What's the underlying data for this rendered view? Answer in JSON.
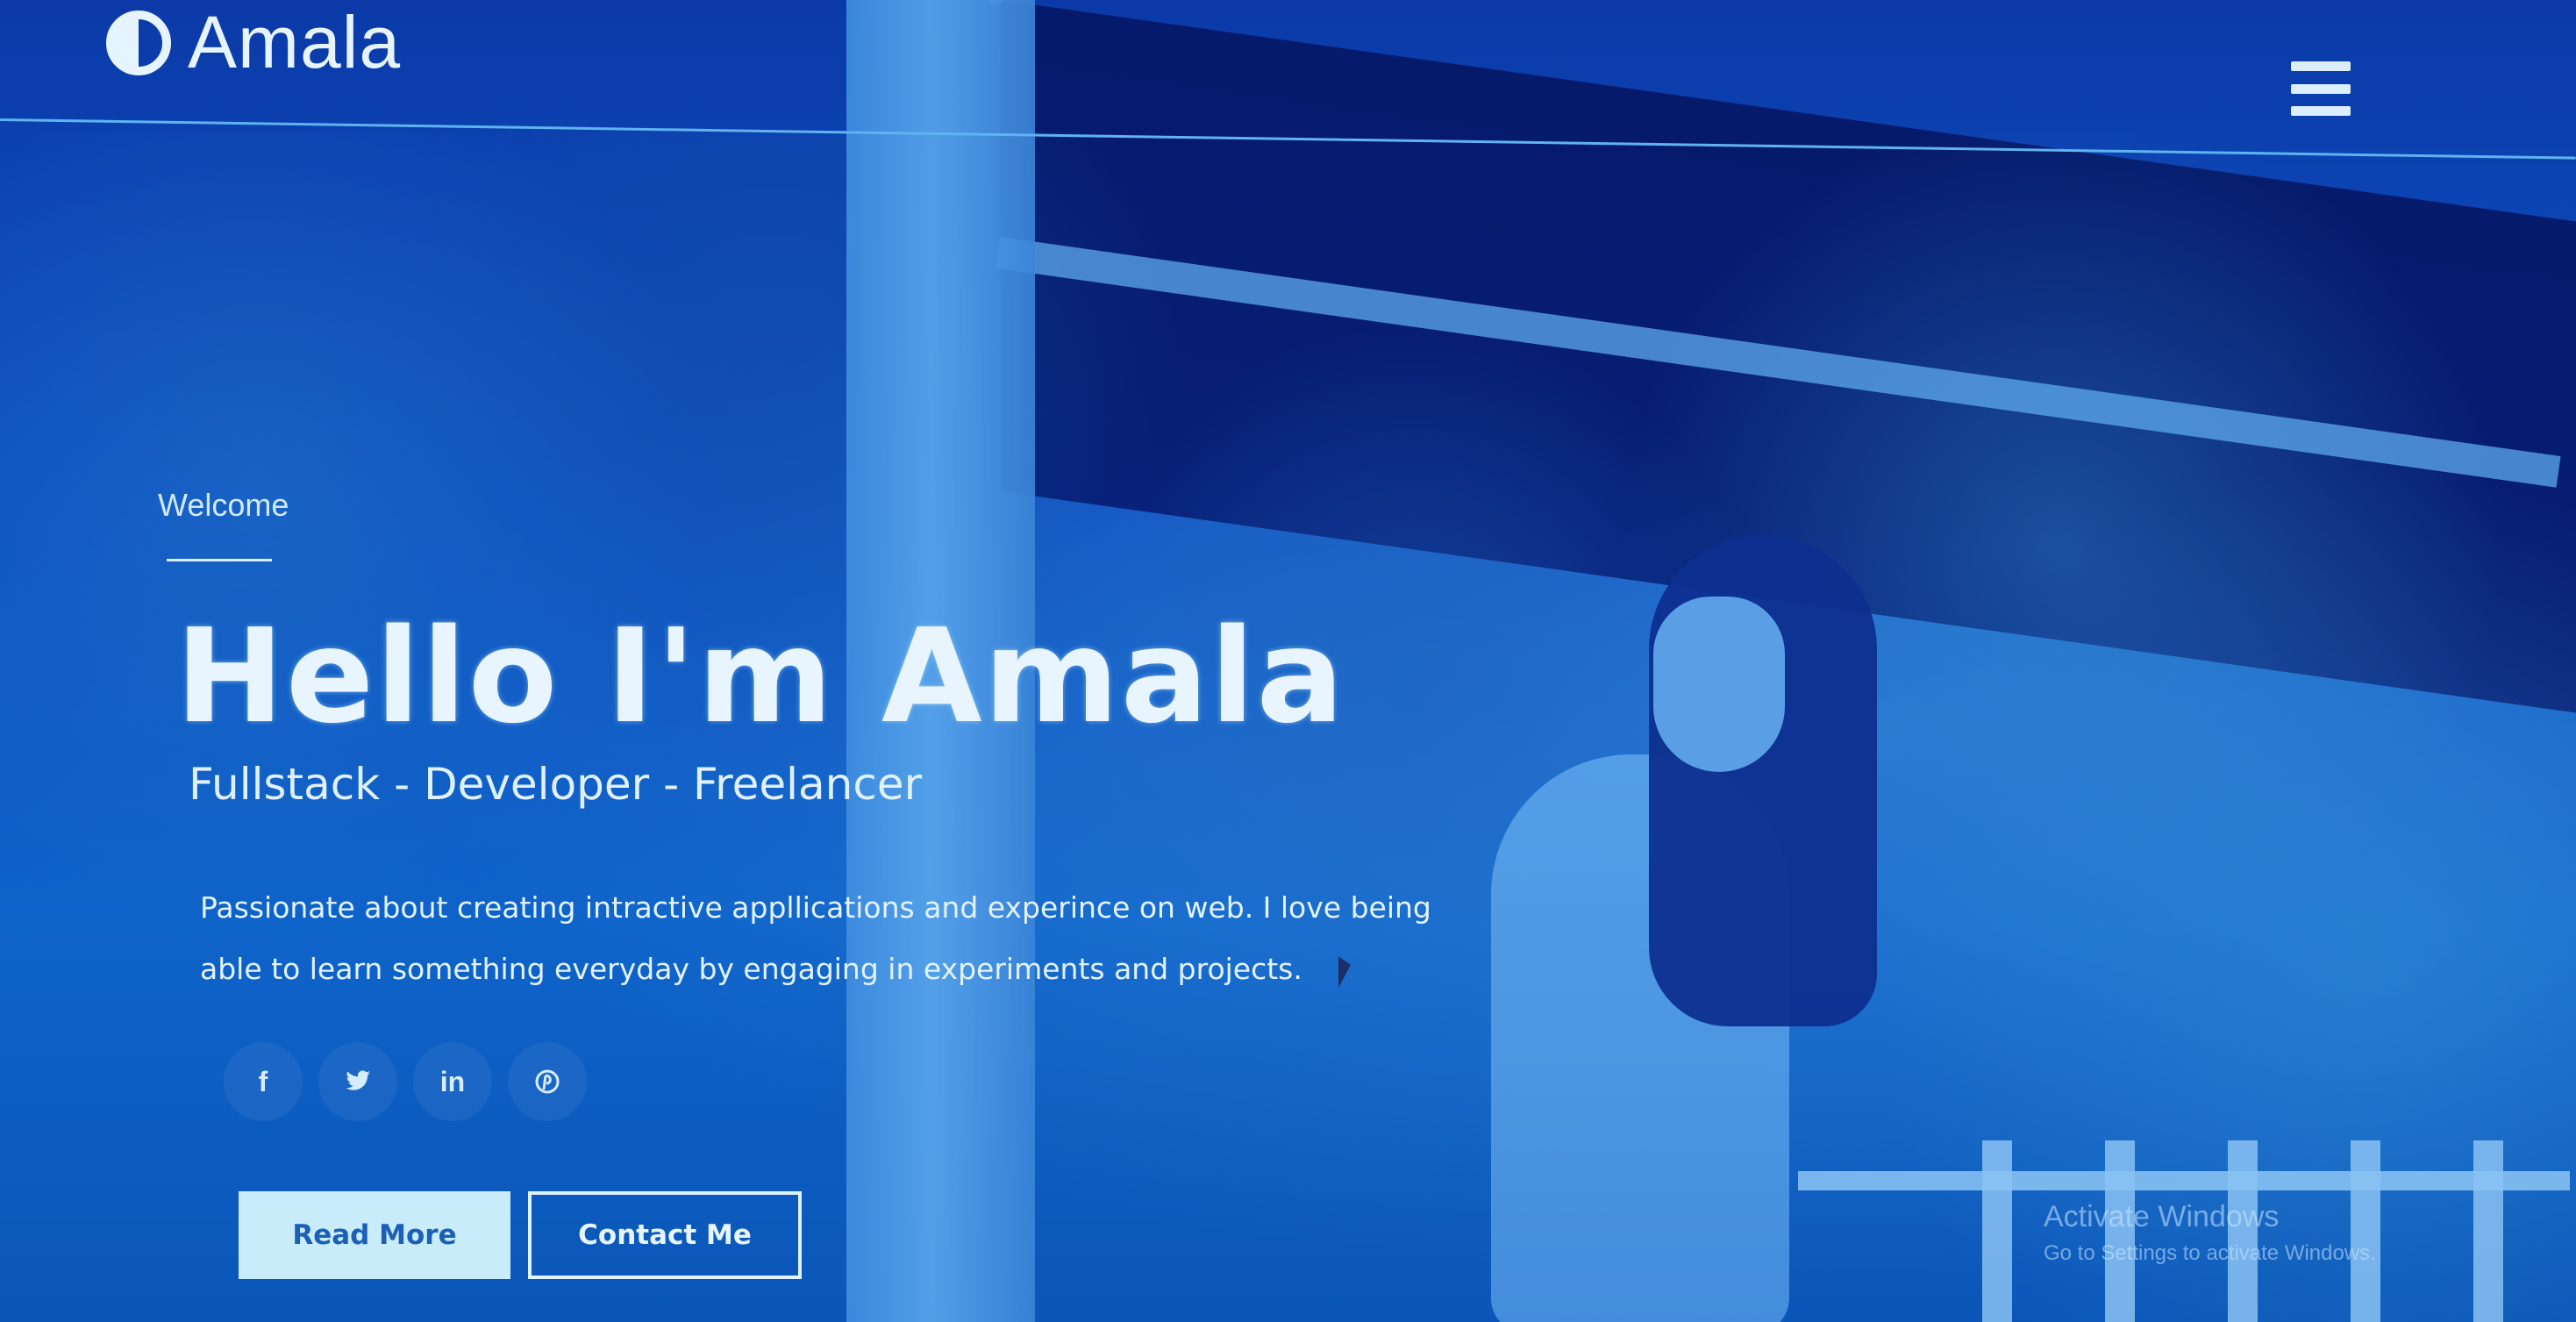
{
  "brand": {
    "name": "Amala"
  },
  "header": {
    "menu_icon": "hamburger-icon"
  },
  "hero": {
    "welcome": "Welcome",
    "title": "Hello I'm Amala",
    "subtitle": "Fullstack - Developer - Freelancer",
    "description": "Passionate about creating intractive appllications and experince on web. I love being able to learn something everyday by engaging in experiments and projects."
  },
  "social": [
    {
      "icon": "facebook-icon",
      "glyph": "f"
    },
    {
      "icon": "twitter-icon",
      "glyph": "🐦"
    },
    {
      "icon": "linkedin-icon",
      "glyph": "in"
    },
    {
      "icon": "pinterest-icon",
      "glyph": "℗"
    }
  ],
  "buttons": {
    "read_more": "Read More",
    "contact_me": "Contact Me"
  },
  "watermark": {
    "title": "Activate Windows",
    "subtitle": "Go to Settings to activate Windows."
  },
  "colors": {
    "background": "#0d4fc0",
    "accent": "#c9ecfb",
    "text": "#e2f3ff"
  }
}
